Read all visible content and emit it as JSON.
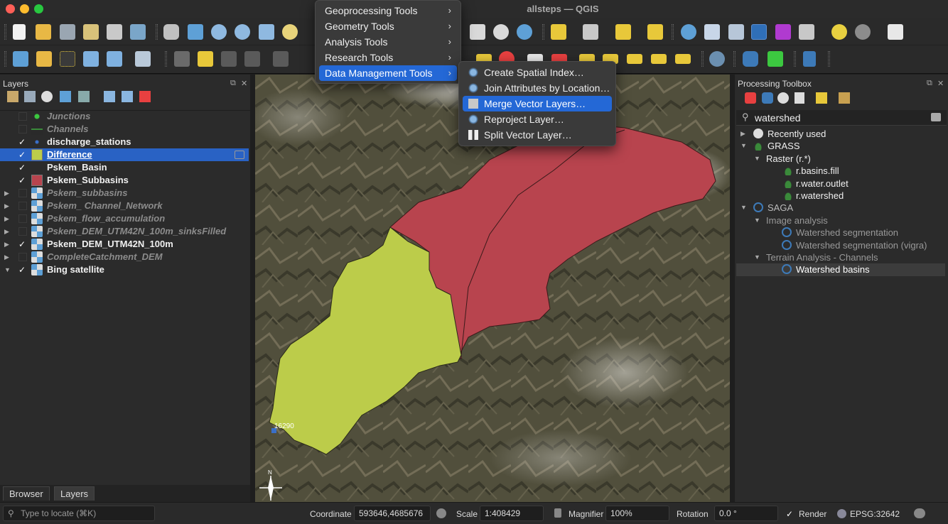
{
  "window": {
    "title": "allsteps — QGIS"
  },
  "layers_panel": {
    "title": "Layers",
    "items": [
      {
        "name": "Junctions",
        "style": "it",
        "checked": false,
        "expander": "",
        "symbol": "point-green"
      },
      {
        "name": "Channels",
        "style": "it",
        "checked": false,
        "expander": "",
        "symbol": "line-green"
      },
      {
        "name": "discharge_stations",
        "style": "bd",
        "checked": true,
        "expander": "",
        "symbol": "point-blue"
      },
      {
        "name": "Difference",
        "style": "bd",
        "checked": true,
        "expander": "",
        "symbol": "fill-yellowgreen",
        "selected": true
      },
      {
        "name": "Pskem_Basin",
        "style": "bd",
        "checked": true,
        "expander": "",
        "symbol": "none"
      },
      {
        "name": "Pskem_Subbasins",
        "style": "bd",
        "checked": true,
        "expander": "",
        "symbol": "fill-red"
      },
      {
        "name": "Pskem_subbasins",
        "style": "it",
        "checked": false,
        "expander": "▶",
        "symbol": "raster"
      },
      {
        "name": "Pskem_ Channel_Network",
        "style": "it",
        "checked": false,
        "expander": "▶",
        "symbol": "raster"
      },
      {
        "name": "Pskem_flow_accumulation",
        "style": "it",
        "checked": false,
        "expander": "▶",
        "symbol": "raster"
      },
      {
        "name": "Pskem_DEM_UTM42N_100m_sinksFilled",
        "style": "it",
        "checked": false,
        "expander": "▶",
        "symbol": "raster"
      },
      {
        "name": "Pskem_DEM_UTM42N_100m",
        "style": "bd",
        "checked": true,
        "expander": "▶",
        "symbol": "raster"
      },
      {
        "name": "CompleteCatchment_DEM",
        "style": "it",
        "checked": false,
        "expander": "▶",
        "symbol": "raster"
      },
      {
        "name": "Bing satellite",
        "style": "bd",
        "checked": true,
        "expander": "▼",
        "symbol": "raster"
      }
    ]
  },
  "bottom_tabs": {
    "browser": "Browser",
    "layers": "Layers"
  },
  "locator": {
    "placeholder": "Type to locate (⌘K)"
  },
  "statusbar": {
    "coordinate_label": "Coordinate",
    "coordinate_value": "593646,4685676",
    "scale_label": "Scale",
    "scale_value": "1:408429",
    "magnifier_label": "Magnifier",
    "magnifier_value": "100%",
    "rotation_label": "Rotation",
    "rotation_value": "0.0 °",
    "render_label": "Render",
    "crs": "EPSG:32642"
  },
  "map": {
    "point_label": "16290"
  },
  "vector_menu": {
    "items": [
      "Geoprocessing Tools",
      "Geometry Tools",
      "Analysis Tools",
      "Research Tools",
      "Data Management Tools"
    ],
    "highlighted": "Data Management Tools"
  },
  "data_mgmt_submenu": {
    "items": [
      "Create Spatial Index…",
      "Join Attributes by Location…",
      "Merge Vector Layers…",
      "Reproject Layer…",
      "Split Vector Layer…"
    ],
    "highlighted": "Merge Vector Layers…"
  },
  "processing_toolbox": {
    "title": "Processing Toolbox",
    "search_value": "watershed",
    "recently_used": "Recently used",
    "grass": "GRASS",
    "grass_raster": "Raster (r.*)",
    "grass_tools": [
      "r.basins.fill",
      "r.water.outlet",
      "r.watershed"
    ],
    "saga": "SAGA",
    "saga_image": "Image analysis",
    "saga_image_tools": [
      "Watershed segmentation",
      "Watershed segmentation (vigra)"
    ],
    "saga_terrain": "Terrain Analysis - Channels",
    "saga_terrain_tools": [
      "Watershed basins"
    ]
  },
  "colors": {
    "selection": "#2962c4",
    "basin_red": "#b8444e",
    "basin_green": "#bccc4a",
    "menu_highlight": "#2468d6"
  }
}
